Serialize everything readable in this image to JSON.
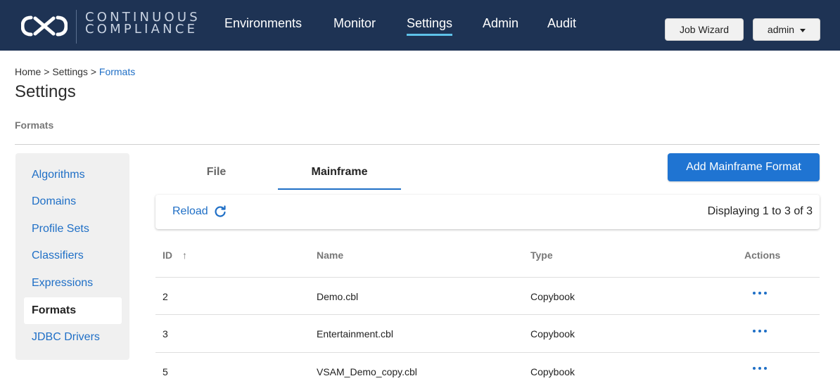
{
  "brand": {
    "line1": "CONTINUOUS",
    "line2": "COMPLIANCE"
  },
  "nav": {
    "environments": "Environments",
    "monitor": "Monitor",
    "settings": "Settings",
    "admin": "Admin",
    "audit": "Audit"
  },
  "header_buttons": {
    "job_wizard": "Job Wizard",
    "user": "admin"
  },
  "breadcrumb": {
    "home": "Home",
    "settings": "Settings",
    "current": "Formats",
    "separator": ">"
  },
  "page": {
    "title": "Settings",
    "section": "Formats"
  },
  "sidebar": {
    "items": [
      {
        "label": "Algorithms"
      },
      {
        "label": "Domains"
      },
      {
        "label": "Profile Sets"
      },
      {
        "label": "Classifiers"
      },
      {
        "label": "Expressions"
      },
      {
        "label": "Formats"
      },
      {
        "label": "JDBC Drivers"
      }
    ]
  },
  "tabs": {
    "file": "File",
    "mainframe": "Mainframe"
  },
  "add_button": "Add Mainframe Format",
  "toolbar": {
    "reload": "Reload",
    "displaying": "Displaying 1 to 3 of 3"
  },
  "table": {
    "headers": {
      "id": "ID",
      "name": "Name",
      "type": "Type",
      "actions": "Actions"
    },
    "rows": [
      {
        "id": "2",
        "name": "Demo.cbl",
        "type": "Copybook"
      },
      {
        "id": "3",
        "name": "Entertainment.cbl",
        "type": "Copybook"
      },
      {
        "id": "5",
        "name": "VSAM_Demo_copy.cbl",
        "type": "Copybook"
      }
    ]
  },
  "colors": {
    "topbar": "#1e3354",
    "accent": "#1f74d2",
    "link": "#1f6fc6",
    "nav_underline": "#5ec2e9"
  }
}
